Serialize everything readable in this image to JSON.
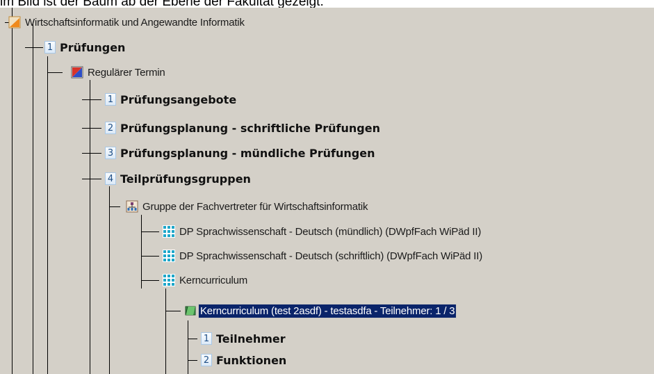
{
  "caption": "im Bild ist der Baum ab der Ebene der Fakultät gezeigt:",
  "colors": {
    "tree_background": "#d4d0c8",
    "selection": "#0a246a",
    "number_badge": "#1f4f86"
  },
  "tree": {
    "root": {
      "icon": "folder-orange-icon",
      "label": "Wirtschaftsinformatik und Angewandte Informatik"
    },
    "pruefungen": {
      "num": "1",
      "label": "Prüfungen"
    },
    "termin": {
      "icon": "calendar-flag-icon",
      "label": "Regulärer Termin"
    },
    "angebote": {
      "num": "1",
      "label": "Prüfungsangebote"
    },
    "schriftlich": {
      "num": "2",
      "label": "Prüfungsplanung - schriftliche Prüfungen"
    },
    "muendlich": {
      "num": "3",
      "label": "Prüfungsplanung - mündliche Prüfungen"
    },
    "teilgruppen": {
      "num": "4",
      "label": "Teilprüfungsgruppen"
    },
    "gruppe": {
      "icon": "group-icon",
      "label": "Gruppe der Fachvertreter für Wirtschaftsinformatik"
    },
    "dp_muendlich": {
      "icon": "grid-icon",
      "label": "DP Sprachwissenschaft - Deutsch (mündlich) (DWpfFach WiPäd II)"
    },
    "dp_schriftlich": {
      "icon": "grid-icon",
      "label": "DP Sprachwissenschaft - Deutsch (schriftlich) (DWpfFach WiPäd II)"
    },
    "kern": {
      "icon": "grid-icon",
      "label": "Kerncurriculum"
    },
    "kern_sel": {
      "icon": "book-icon",
      "label": "Kerncurriculum (test 2asdf) - testasdfa - Teilnehmer: 1 / 3"
    },
    "teilnehmer": {
      "num": "1",
      "label": "Teilnehmer"
    },
    "funktionen": {
      "num": "2",
      "label": "Funktionen"
    }
  }
}
